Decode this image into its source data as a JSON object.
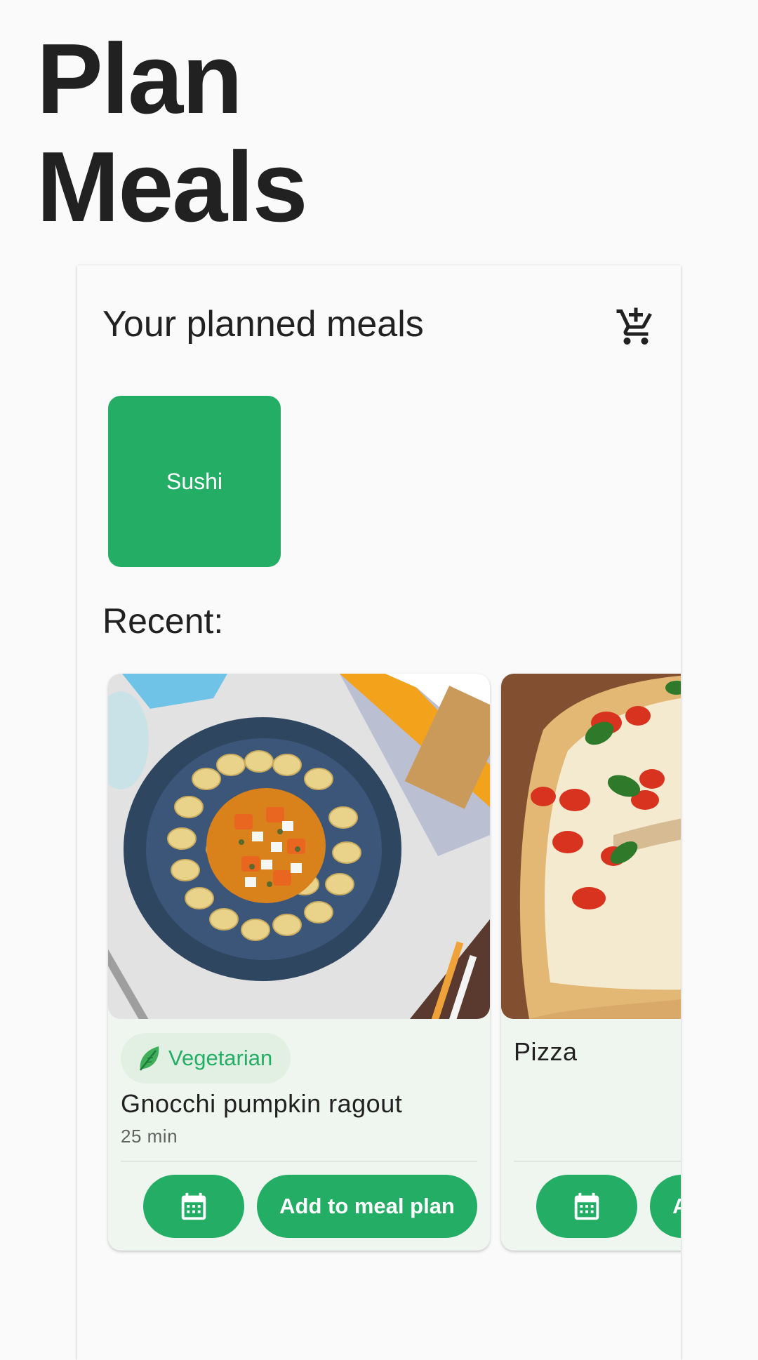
{
  "header": {
    "title_line1": "Plan",
    "title_line2": "Meals"
  },
  "planned": {
    "title": "Your planned meals",
    "cart_icon": "add-shopping-cart-icon",
    "meals": [
      {
        "name": "Sushi",
        "color": "#23ad65"
      }
    ]
  },
  "recent": {
    "label": "Recent:",
    "recipes": [
      {
        "name": "Gnocchi pumpkin ragout",
        "time": "25 min",
        "tag": "Vegetarian",
        "tag_icon": "leaf-icon",
        "calendar_icon": "calendar-icon",
        "add_label": "Add to meal plan"
      },
      {
        "name": "Pizza",
        "calendar_icon": "calendar-icon",
        "add_label": "Add to meal plan"
      }
    ]
  },
  "colors": {
    "accent": "#23ad65",
    "background": "#fafafa",
    "card_background": "#eff5ef",
    "text": "#212121"
  }
}
